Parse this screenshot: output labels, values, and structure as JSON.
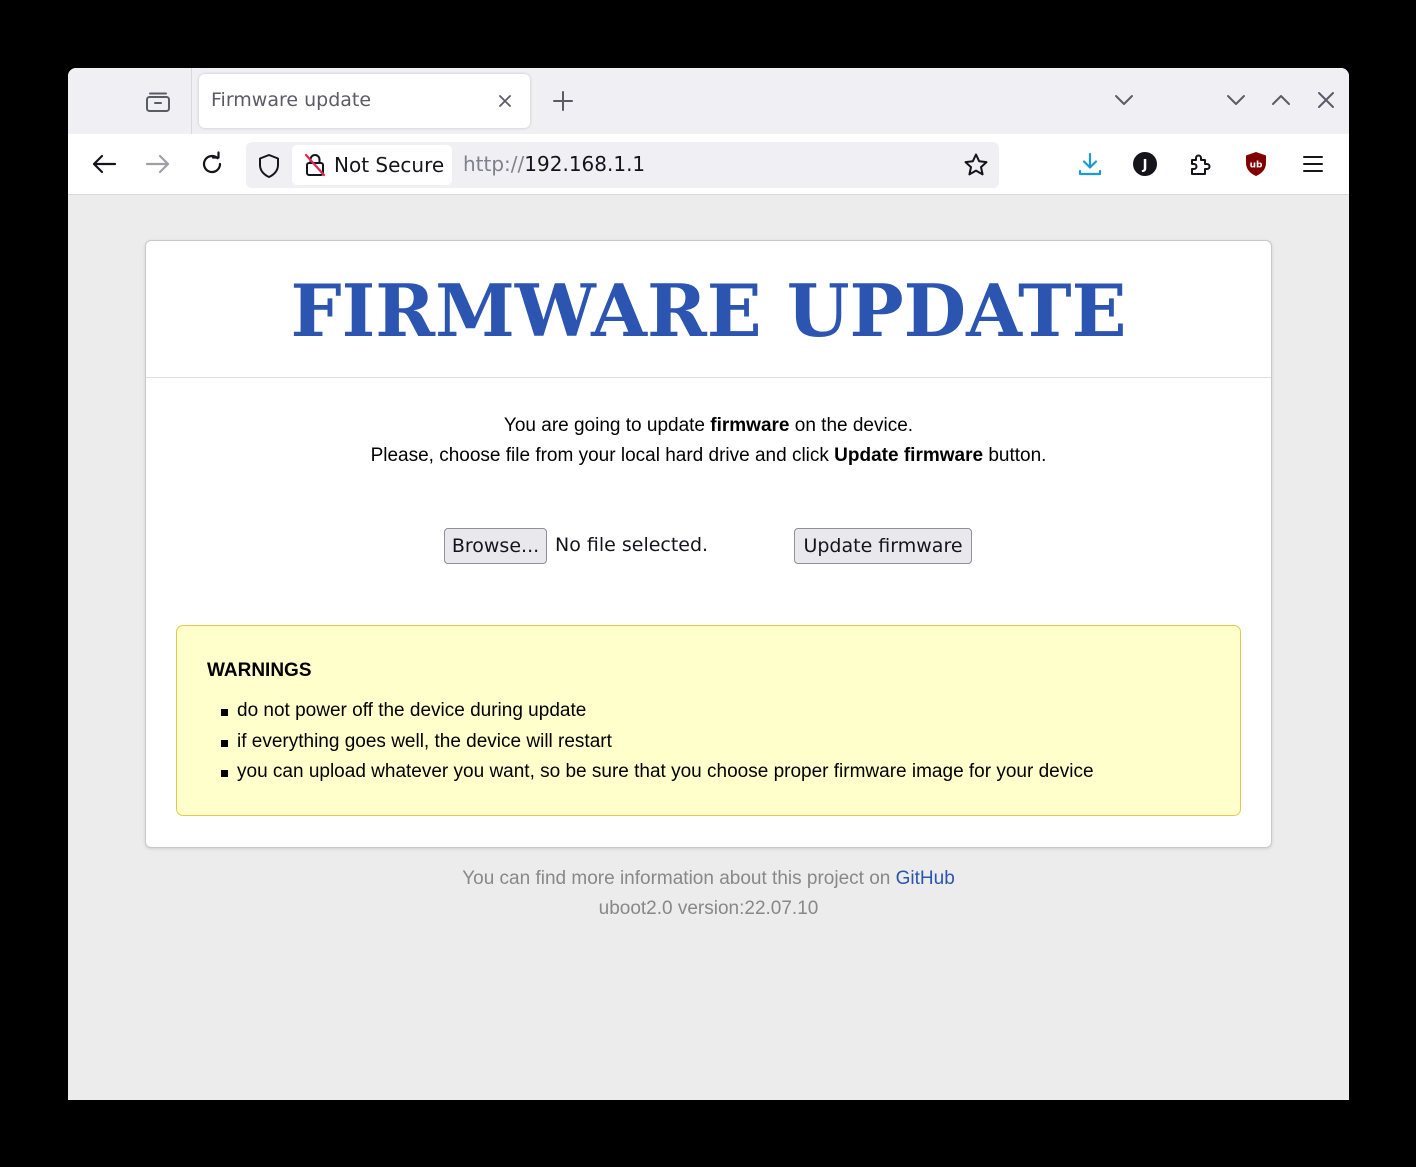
{
  "browser": {
    "tab": {
      "title": "Firmware update"
    },
    "urlbar": {
      "security_label": "Not Secure",
      "url_scheme": "http://",
      "url_host": "192.168.1.1"
    },
    "toolbar": {
      "account_initial": "J"
    },
    "accent": "#1a9bd7"
  },
  "page": {
    "title": "FIRMWARE UPDATE",
    "intro": {
      "line1_pre": "You are going to update ",
      "line1_bold": "firmware",
      "line1_post": " on the device.",
      "line2_pre": "Please, choose file from your local hard drive and click ",
      "line2_bold": "Update firmware",
      "line2_post": " button."
    },
    "form": {
      "browse_label": "Browse...",
      "file_status": "No file selected.",
      "submit_label": "Update firmware"
    },
    "warnings": {
      "title": "WARNINGS",
      "items": [
        "do not power off the device during update",
        "if everything goes well, the device will restart",
        "you can upload whatever you want, so be sure that you choose proper firmware image for your device"
      ]
    },
    "footer": {
      "info_pre": "You can find more information about this project on ",
      "link_text": "GitHub",
      "version": "uboot2.0 version:22.07.10"
    },
    "colors": {
      "title": "#2b55b0",
      "warning_bg": "#ffffcc",
      "warning_border": "#e8c84a"
    }
  }
}
